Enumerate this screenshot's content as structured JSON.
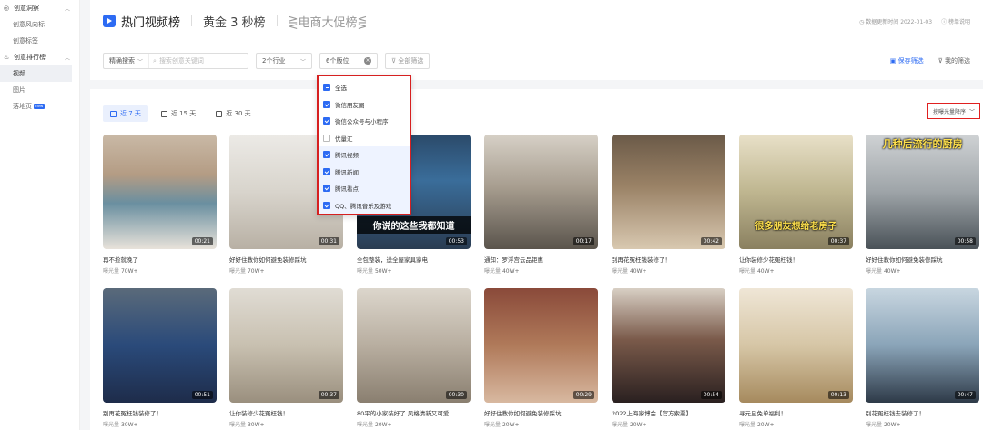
{
  "sidebar": {
    "groups": [
      {
        "label": "创意洞察",
        "items": [
          "创意风向标",
          "创意标签"
        ]
      },
      {
        "label": "创意排行榜",
        "items": [
          "视频",
          "图片",
          "落地页"
        ]
      }
    ],
    "new_badge": "new"
  },
  "header": {
    "title": "热门视频榜",
    "sub1": "黄金 3 秒榜",
    "sub2": "⋛电商大促榜⋚",
    "update_time": "数据更新时间 2022-01-03",
    "guide": "榜单说明"
  },
  "filters": {
    "search_mode": "精确搜索",
    "search_placeholder": "搜索创意关键词",
    "industry": "2个行业",
    "placement": "6个版位",
    "all_filter": "全部筛选",
    "save_filter": "保存筛选",
    "my_filter": "我的筛选"
  },
  "tabs": [
    "近 7 天",
    "近 15 天",
    "近 30 天"
  ],
  "sort_label": "按曝光量降序",
  "placement_options": [
    {
      "label": "全选",
      "state": "partial"
    },
    {
      "label": "微信朋友圈",
      "state": "on"
    },
    {
      "label": "微信公众号与小程序",
      "state": "on"
    },
    {
      "label": "优量汇",
      "state": "off"
    },
    {
      "label": "腾讯视频",
      "state": "on"
    },
    {
      "label": "腾讯新闻",
      "state": "on"
    },
    {
      "label": "腾讯看点",
      "state": "on"
    },
    {
      "label": "QQ、腾讯音乐及游戏",
      "state": "on"
    }
  ],
  "stat_label": "曝光量",
  "cards": [
    {
      "title": "再不捡就晚了",
      "stat": "70W+",
      "dur": "00:21",
      "overlay": ""
    },
    {
      "title": "好好住教你如何避免装修踩坑",
      "stat": "70W+",
      "dur": "00:31",
      "overlay": ""
    },
    {
      "title": "全包整装，送全屋家具家电",
      "stat": "50W+",
      "dur": "00:53",
      "overlay": "你说的这些我都知道"
    },
    {
      "title": "通知：罗浮宫云品钜惠",
      "stat": "40W+",
      "dur": "00:17",
      "overlay": ""
    },
    {
      "title": "别再花冤枉钱装修了！",
      "stat": "40W+",
      "dur": "00:42",
      "overlay": ""
    },
    {
      "title": "让你装修少花冤枉钱！",
      "stat": "40W+",
      "dur": "00:37",
      "overlay": "很多朋友想给老房子"
    },
    {
      "title": "好好住教你如何避免装修踩坑",
      "stat": "40W+",
      "dur": "00:58",
      "overlay": "几种后流行的厨房"
    },
    {
      "title": "别再花冤枉钱装修了！",
      "stat": "30W+",
      "dur": "00:51",
      "overlay": ""
    },
    {
      "title": "让你装修少花冤枉钱！",
      "stat": "30W+",
      "dur": "00:37",
      "overlay": ""
    },
    {
      "title": "80平的小家装好了 风格清新又可爱 …",
      "stat": "20W+",
      "dur": "00:30",
      "overlay": ""
    },
    {
      "title": "好好住教你如何避免装修踩坑",
      "stat": "20W+",
      "dur": "00:29",
      "overlay": ""
    },
    {
      "title": "2022上海家博会【官方索票】",
      "stat": "20W+",
      "dur": "00:54",
      "overlay": ""
    },
    {
      "title": "寻元旦免单福利！",
      "stat": "20W+",
      "dur": "00:13",
      "overlay": ""
    },
    {
      "title": "别花冤枉钱去装修了！",
      "stat": "20W+",
      "dur": "00:47",
      "overlay": ""
    }
  ]
}
